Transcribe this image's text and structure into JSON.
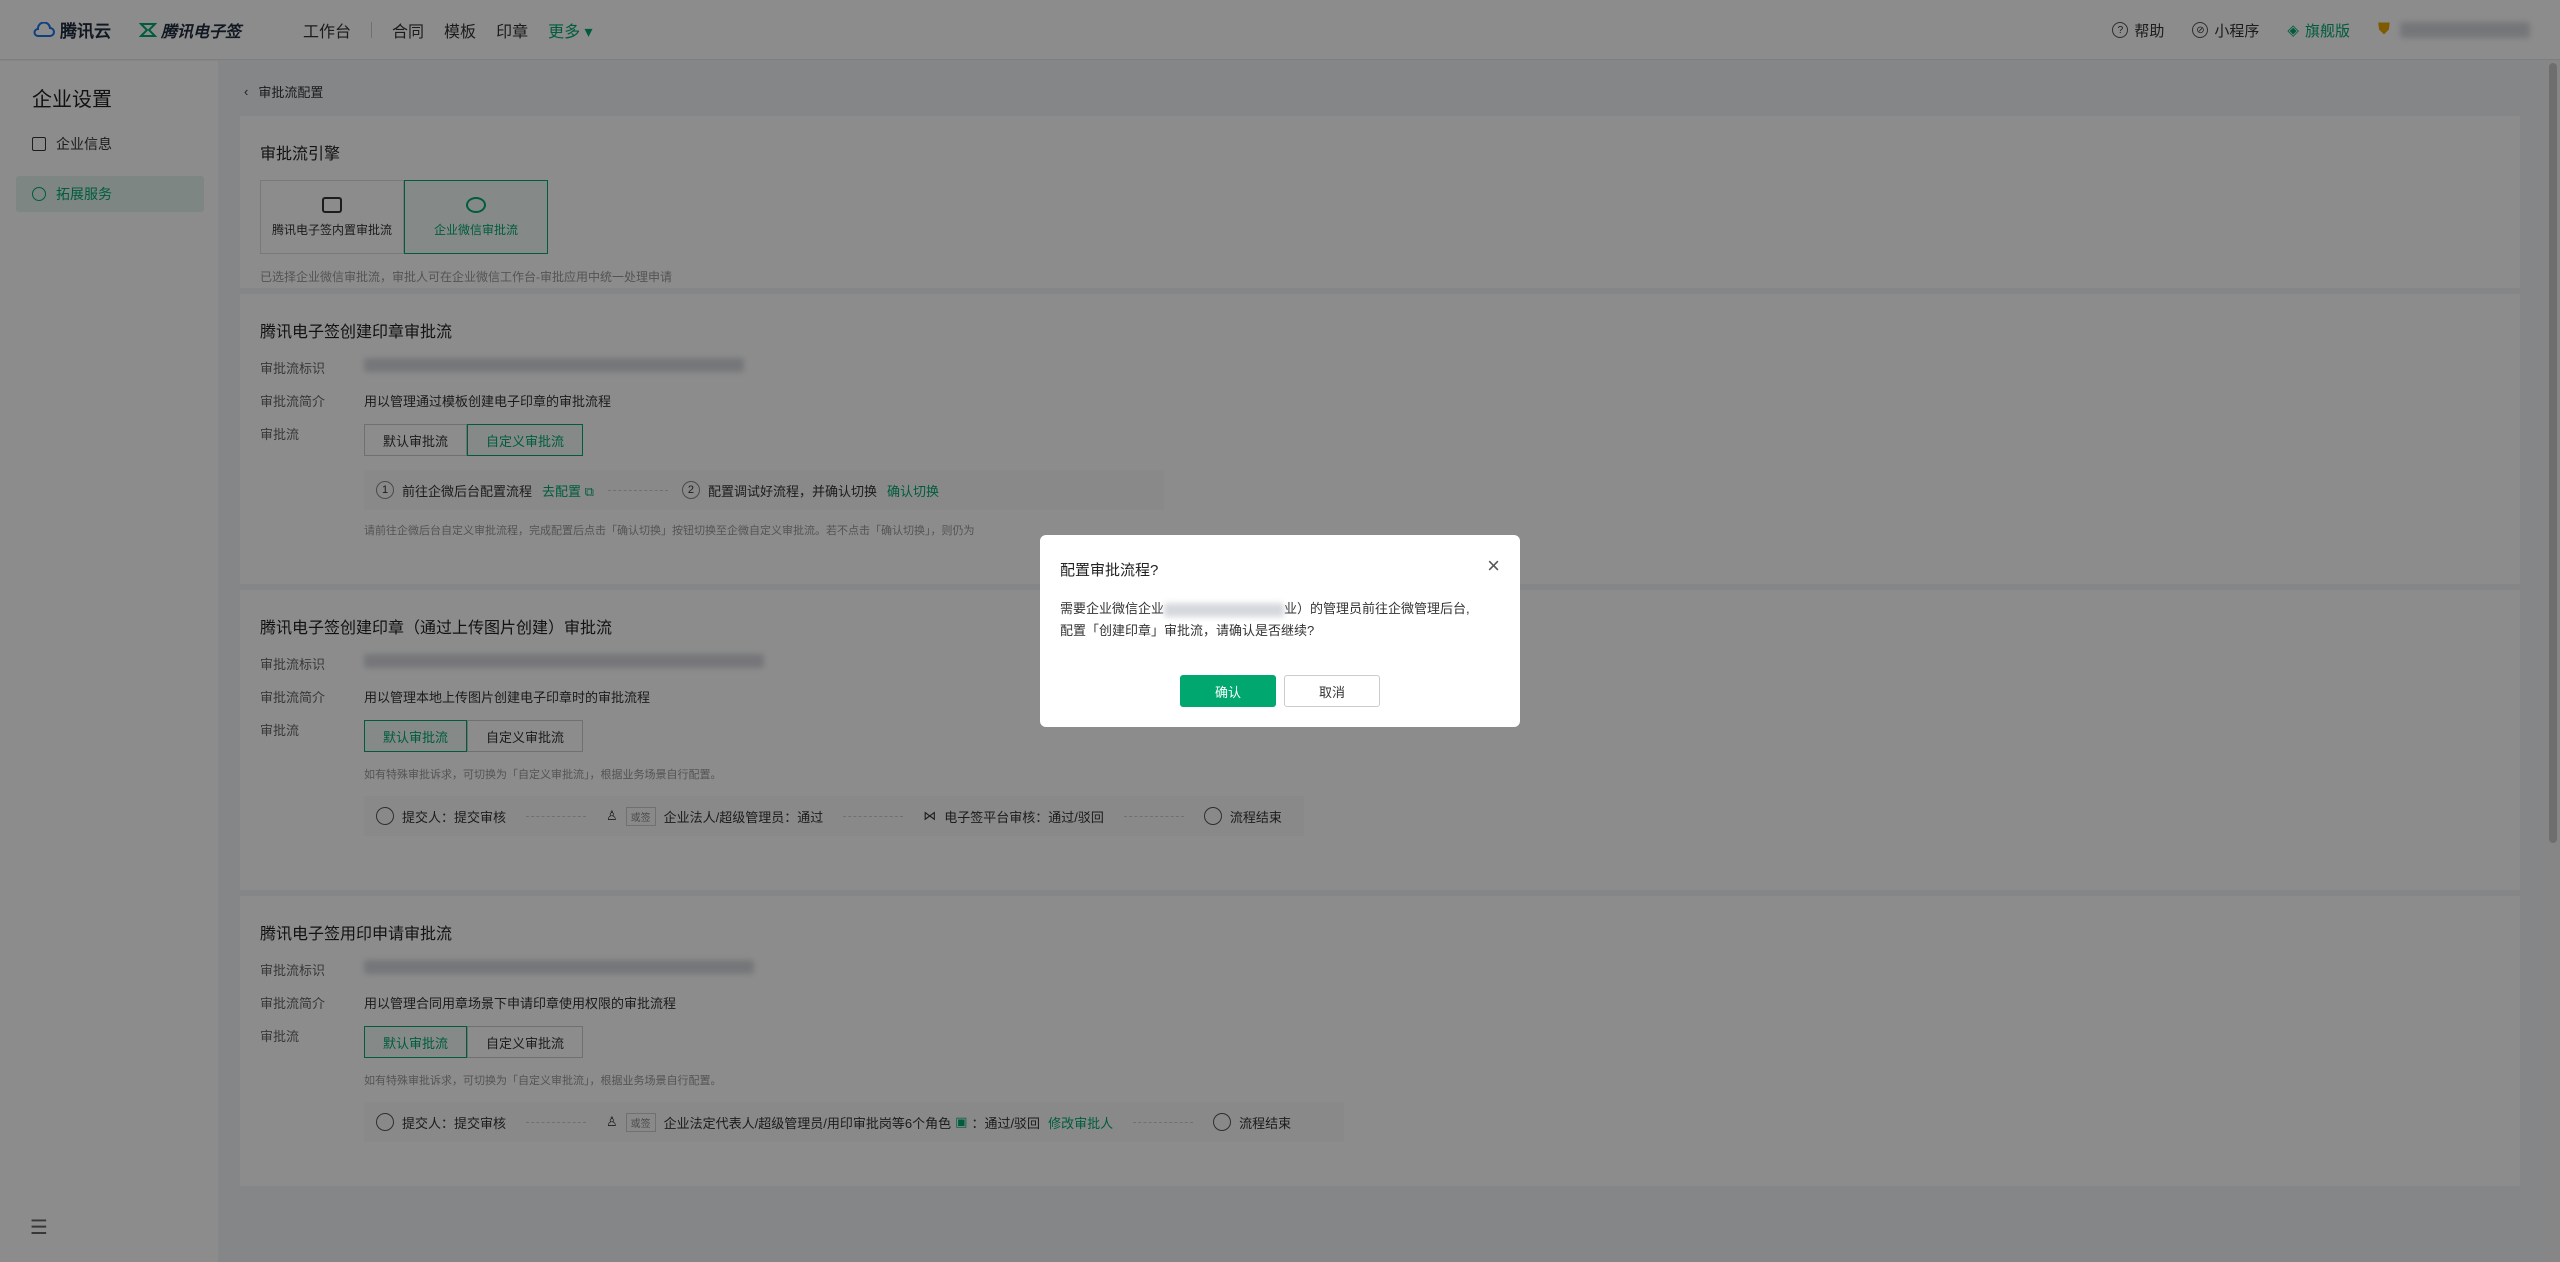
{
  "topbar": {
    "brand1": "腾讯云",
    "brand2": "腾讯电子签",
    "nav": [
      "工作台",
      "合同",
      "模板",
      "印章"
    ],
    "more": "更多",
    "help": "帮助",
    "miniprogram": "小程序",
    "edition": "旗舰版"
  },
  "sidebar": {
    "title": "企业设置",
    "items": [
      {
        "label": "企业信息",
        "active": false
      },
      {
        "label": "拓展服务",
        "active": true
      }
    ]
  },
  "breadcrumb": "审批流配置",
  "engine": {
    "title": "审批流引擎",
    "options": [
      {
        "label": "腾讯电子签内置审批流",
        "selected": false
      },
      {
        "label": "企业微信审批流",
        "selected": true
      }
    ],
    "hint": "已选择企业微信审批流，审批人可在企业微信工作台-审批应用中统一处理申请"
  },
  "flows": [
    {
      "title": "腾讯电子签创建印章审批流",
      "id_label": "审批流标识",
      "desc_label": "审批流简介",
      "desc": "用以管理通过模板创建电子印章的审批流程",
      "flow_label": "审批流",
      "seg": [
        "默认审批流",
        "自定义审批流"
      ],
      "step1": "前往企微后台配置流程",
      "step1_link": "去配置",
      "step2": "配置调试好流程，并确认切换",
      "step2_link": "确认切换",
      "note": "请前往企微后台自定义审批流程，完成配置后点击「确认切换」按钮切换至企微自定义审批流。若不点击「确认切换」，则仍为"
    },
    {
      "title": "腾讯电子签创建印章（通过上传图片创建）审批流",
      "id_label": "审批流标识",
      "desc_label": "审批流简介",
      "desc": "用以管理本地上传图片创建电子印章时的审批流程",
      "flow_label": "审批流",
      "seg": [
        "默认审批流",
        "自定义审批流"
      ],
      "note": "如有特殊审批诉求，可切换为「自定义审批流」，根据业务场景自行配置。",
      "nodes": [
        "提交人：提交审核",
        "企业法人/超级管理员：通过",
        "电子签平台审核：通过/驳回",
        "流程结束"
      ],
      "or_tag": "或签"
    },
    {
      "title": "腾讯电子签用印申请审批流",
      "id_label": "审批流标识",
      "desc_label": "审批流简介",
      "desc": "用以管理合同用章场景下申请印章使用权限的审批流程",
      "flow_label": "审批流",
      "seg": [
        "默认审批流",
        "自定义审批流"
      ],
      "note": "如有特殊审批诉求，可切换为「自定义审批流」，根据业务场景自行配置。",
      "nodes": [
        "提交人：提交审核",
        "企业法定代表人/超级管理员/用印审批岗等6个角色",
        "：通过/驳回",
        "修改审批人",
        "流程结束"
      ],
      "or_tag": "或签"
    }
  ],
  "dialog": {
    "title": "配置审批流程?",
    "line1_prefix": "需要企业微信企业",
    "line1_suffix": "业）的管理员前往企微管理后台,",
    "line2": "配置「创建印章」审批流，请确认是否继续?",
    "confirm": "确认",
    "cancel": "取消"
  }
}
